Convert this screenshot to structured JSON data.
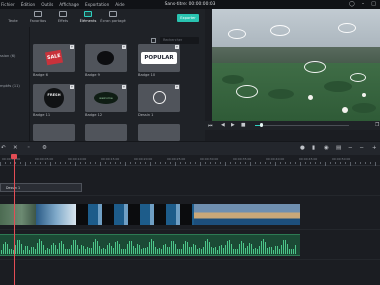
{
  "window": {
    "title": "Sans-titre: 00:00:00:03",
    "menu": [
      "Fichier",
      "Édition",
      "Outils",
      "Affichage",
      "Exportation",
      "Aide"
    ]
  },
  "library": {
    "tabs": [
      {
        "label": "Texte",
        "icon": "media-icon"
      },
      {
        "label": "Favoritos",
        "icon": "favorites-icon"
      },
      {
        "label": "Effets",
        "icon": "effects-icon"
      },
      {
        "label": "Éléments",
        "icon": "elements-icon",
        "active": true
      },
      {
        "label": "Écran partagé",
        "icon": "split-screen-icon"
      }
    ],
    "export_label": "Exporter",
    "categories": [
      "ssion (6)",
      "mptés (11)"
    ],
    "search_placeholder": "Rechercher",
    "items": [
      {
        "label": "Badge 6"
      },
      {
        "label": "Badge 9"
      },
      {
        "label": "Badge 10"
      },
      {
        "label": "Badge 11"
      },
      {
        "label": "Badge 12"
      },
      {
        "label": "Dessin 1"
      }
    ],
    "badge_texts": {
      "sale": "SALE",
      "popular": "POPULAR",
      "fresh": "FRESH",
      "welcome": "welcome"
    }
  },
  "preview": {
    "progress": 0.07
  },
  "timeline": {
    "ruler_labels": [
      "00:00:00:00",
      "00:00:05:00",
      "00:00:10:00",
      "00:00:15:00",
      "00:00:20:00",
      "00:00:25:00",
      "00:00:30:00",
      "00:00:35:00",
      "00:00:40:00",
      "00:00:45:00",
      "00:00:50:00"
    ],
    "element_clip_label": "Dessin 1"
  },
  "colors": {
    "accent": "#2fd1c1",
    "export_button": "#29c3b0",
    "playhead": "#e34d55",
    "audio": "#4cc68a"
  }
}
